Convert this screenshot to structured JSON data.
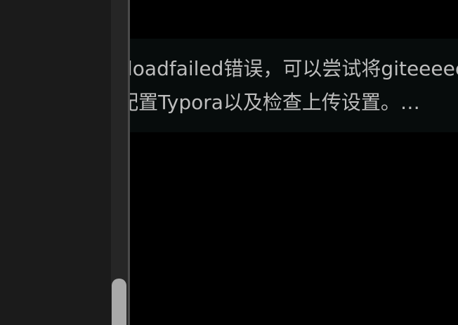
{
  "search_result": {
    "snippet_line1": "loadfailed错误，可以尝试将giteeeee",
    "snippet_line2": "配置Typora以及检查上传设置。…"
  },
  "colors": {
    "sidebar_bg": "#1b1b1b",
    "scrollbar_track": "#262626",
    "scrollbar_thumb": "#a9a9a9",
    "main_bg": "#000000",
    "snippet_bg": "#070c0c",
    "snippet_text": "#bdbdbd"
  }
}
